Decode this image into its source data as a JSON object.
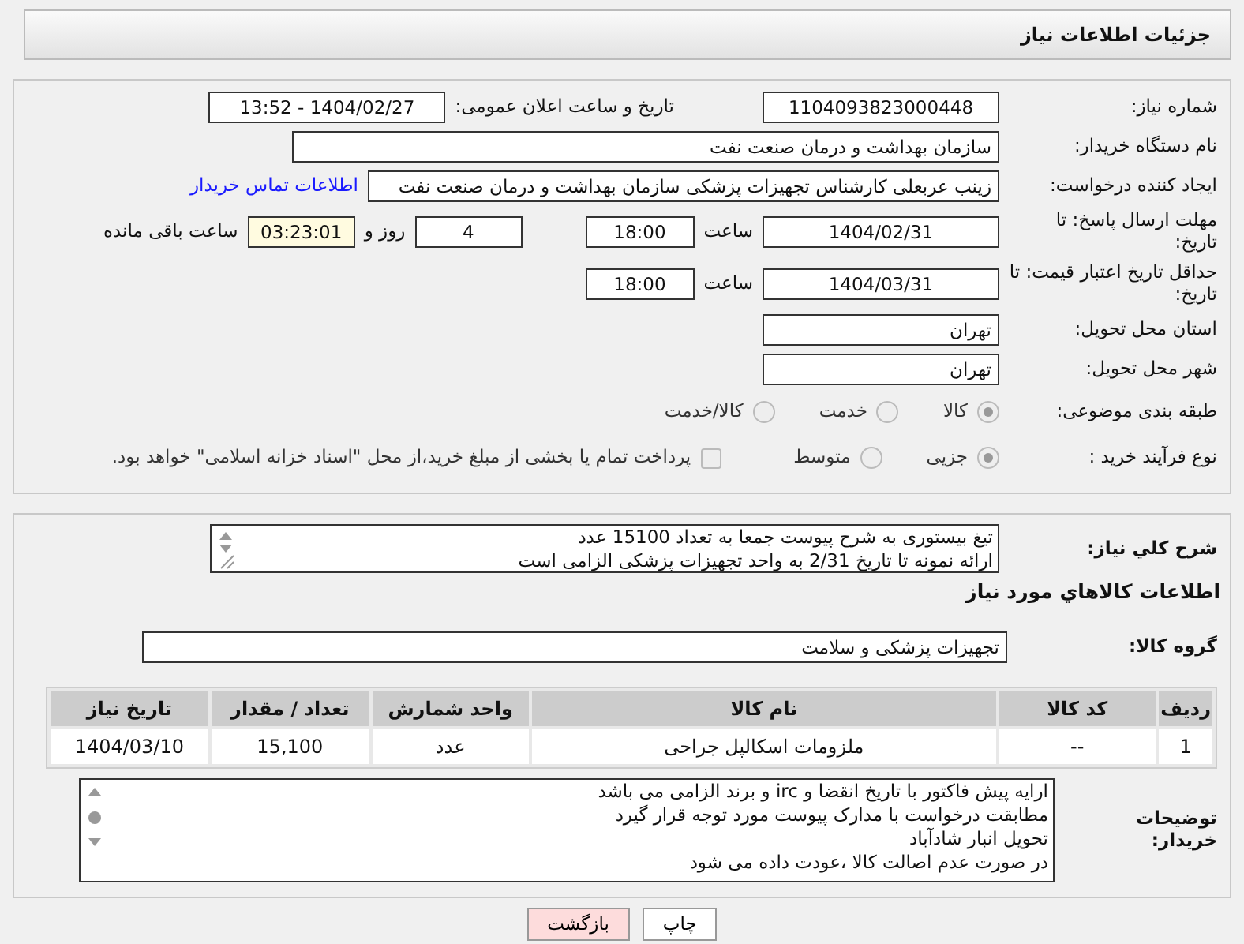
{
  "page_title": "جزئیات اطلاعات نیاز",
  "need_number": {
    "label": "شماره نیاز:",
    "value": "1104093823000448"
  },
  "announce": {
    "label": "تاریخ و ساعت اعلان عمومی:",
    "value": "1404/02/27 - 13:52"
  },
  "buyer_org": {
    "label": "نام دستگاه خریدار:",
    "value": "سازمان بهداشت و درمان صنعت نفت"
  },
  "requester": {
    "label": "ایجاد کننده درخواست:",
    "value": "زینب عربعلی کارشناس تجهیزات پزشکی سازمان بهداشت و درمان صنعت نفت",
    "link": "اطلاعات تماس خریدار"
  },
  "reply_deadline": {
    "label": "مهلت ارسال پاسخ: تا تاریخ:",
    "date": "1404/02/31",
    "time_label": "ساعت",
    "time": "18:00",
    "days": "4",
    "days_label": "روز و",
    "remaining": "03:23:01",
    "remaining_label": "ساعت باقی مانده"
  },
  "price_validity": {
    "label": "حداقل تاریخ اعتبار قیمت: تا تاریخ:",
    "date": "1404/03/31",
    "time_label": "ساعت",
    "time": "18:00"
  },
  "province": {
    "label": "استان محل تحویل:",
    "value": "تهران"
  },
  "city": {
    "label": "شهر محل تحویل:",
    "value": "تهران"
  },
  "category": {
    "label": "طبقه بندی موضوعی:",
    "options": [
      {
        "label": "کالا",
        "selected": true
      },
      {
        "label": "خدمت",
        "selected": false
      },
      {
        "label": "کالا/خدمت",
        "selected": false
      }
    ]
  },
  "process": {
    "label": "نوع فرآیند خرید :",
    "options": [
      {
        "label": "جزیی",
        "selected": true
      },
      {
        "label": "متوسط",
        "selected": false
      }
    ],
    "treasury": {
      "label": "پرداخت تمام یا بخشی از مبلغ خرید،از محل \"اسناد خزانه اسلامی\" خواهد بود.",
      "checked": false
    }
  },
  "description": {
    "label": "شرح کلي نياز:",
    "lines": [
      "تیغ بیستوری به شرح پیوست جمعا به تعداد 15100 عدد",
      "ارائه نمونه تا تاریخ 2/31 به واحد تجهیزات پزشکی  الزامی است"
    ]
  },
  "goods_title": "اطلاعات کالاهاي مورد نياز",
  "goods_group": {
    "label": "گروه کالا:",
    "value": "تجهیزات پزشکی و سلامت"
  },
  "table": {
    "columns": [
      "ردیف",
      "کد کالا",
      "نام کالا",
      "واحد شمارش",
      "تعداد / مقدار",
      "تاریخ نیاز"
    ],
    "rows": [
      [
        "1",
        "--",
        "ملزومات اسکالپل جراحی",
        "عدد",
        "15,100",
        "1404/03/10"
      ]
    ]
  },
  "buyer_notes": {
    "label": "توضیحات خریدار:",
    "lines": [
      "ارایه  پیش فاکتور با تاریخ انقضا و irc  و برند الزامی می باشد",
      "مطابقت درخواست با مدارک پیوست مورد توجه قرار گیرد",
      "تحویل انبار شادآباد",
      "در صورت عدم اصالت کالا ،عودت داده می شود"
    ]
  },
  "buttons": [
    {
      "label": "چاپ",
      "kind": "print"
    },
    {
      "label": "بازگشت",
      "kind": "back"
    }
  ]
}
